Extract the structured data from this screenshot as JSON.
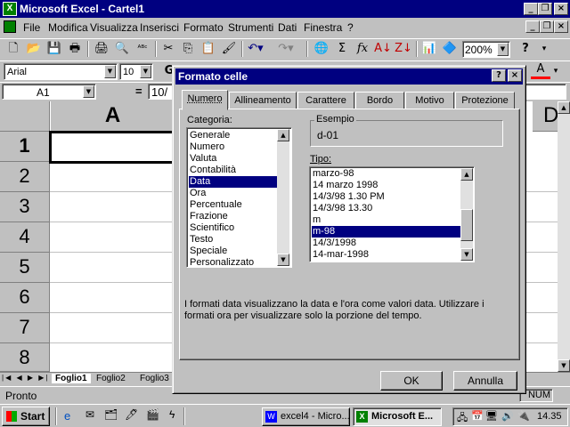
{
  "app": {
    "title": "Microsoft Excel - Cartel1"
  },
  "menu": [
    "File",
    "Modifica",
    "Visualizza",
    "Inserisci",
    "Formato",
    "Strumenti",
    "Dati",
    "Finestra",
    "?"
  ],
  "toolbar": {
    "zoom": "200%",
    "help": "?"
  },
  "format": {
    "font": "Arial",
    "size": "10"
  },
  "formula": {
    "namebox": "A1",
    "eq": "=",
    "value": "10/"
  },
  "columns": [
    "A",
    "D"
  ],
  "rows": [
    "1",
    "2",
    "3",
    "4",
    "5",
    "6",
    "7",
    "8"
  ],
  "sheets": [
    "Foglio1",
    "Foglio2",
    "Foglio3"
  ],
  "status": {
    "left": "Pronto",
    "right": "NUM"
  },
  "dialog": {
    "title": "Formato celle",
    "tabs": [
      "Numero",
      "Allineamento",
      "Carattere",
      "Bordo",
      "Motivo",
      "Protezione"
    ],
    "categoria_label": "Categoria:",
    "categories": [
      "Generale",
      "Numero",
      "Valuta",
      "Contabilità",
      "Data",
      "Ora",
      "Percentuale",
      "Frazione",
      "Scientifico",
      "Testo",
      "Speciale",
      "Personalizzato"
    ],
    "selected_category": "Data",
    "esempio_label": "Esempio",
    "esempio_value": "d-01",
    "tipo_label": "Tipo:",
    "tipi": [
      "marzo-98",
      "14 marzo 1998",
      "14/3/98 1.30 PM",
      "14/3/98 13.30",
      "m",
      "m-98",
      "14/3/1998",
      "14-mar-1998"
    ],
    "selected_tipo": "m-98",
    "description": "I formati data visualizzano la data e l'ora come valori data. Utilizzare i formati ora per visualizzare solo la porzione del tempo.",
    "ok": "OK",
    "cancel": "Annulla"
  },
  "taskbar": {
    "start": "Start",
    "tasks": [
      "excel4 - Micro...",
      "Microsoft E..."
    ],
    "clock": "14.35"
  }
}
